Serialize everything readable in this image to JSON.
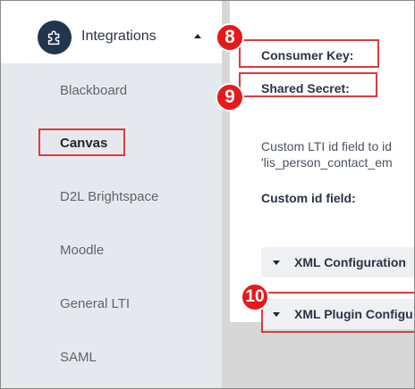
{
  "sidebar": {
    "header": {
      "label": "Integrations",
      "icon": "puzzle-icon",
      "expanded_icon": "caret-up-icon"
    },
    "items": [
      {
        "label": "Blackboard"
      },
      {
        "label": "Canvas",
        "active": true
      },
      {
        "label": "D2L Brightspace"
      },
      {
        "label": "Moodle"
      },
      {
        "label": "General LTI"
      },
      {
        "label": "SAML"
      }
    ]
  },
  "main": {
    "consumer_key_label": "Consumer Key:",
    "shared_secret_label": "Shared Secret:",
    "custom_lti_line1": "Custom LTI id field to id",
    "custom_lti_line2": "'lis_person_contact_em",
    "custom_id_label": "Custom id field:",
    "accordions": [
      {
        "label": "XML Configuration",
        "icon": "triangle-down-icon"
      },
      {
        "label": "XML Plugin Configu",
        "icon": "triangle-down-icon"
      }
    ]
  },
  "annotations": {
    "badge_8": "8",
    "badge_9": "9",
    "badge_10": "10"
  },
  "colors": {
    "highlight": "#e0393e",
    "badge": "#e51a1a",
    "sidebar_bg": "#e5e9ee",
    "icon_circle": "#22354e"
  }
}
